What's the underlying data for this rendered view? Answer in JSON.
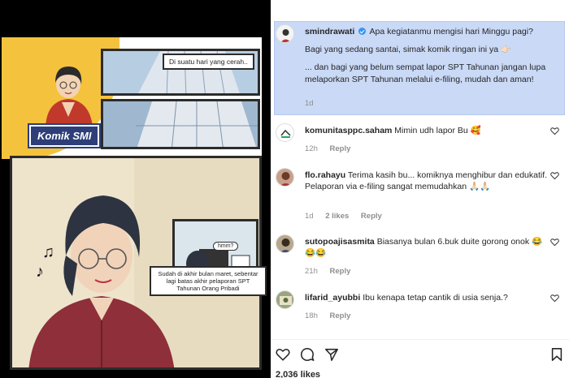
{
  "comic": {
    "caption_top": "Di suatu hari yang cerah..",
    "badge": "Komik SMI",
    "hmm": "hmm?",
    "caption_bottom": "Sudah di akhir bulan maret, sebentar lagi batas akhir pelaporan SPT Tahunan Orang Pribadi"
  },
  "post": {
    "author": "smindrawati",
    "caption_line1": "Apa kegiatanmu mengisi hari Minggu pagi?",
    "caption_line2": "Bagi yang sedang santai, simak komik ringan ini ya 👉🏻",
    "caption_line3": "... dan bagi yang belum sempat lapor SPT Tahunan jangan lupa melaporkan SPT Tahunan melalui e-filing, mudah dan aman!",
    "time": "1d"
  },
  "comments": [
    {
      "user": "komunitasppc.saham",
      "text": "Mimin udh lapor Bu 🥰",
      "time": "12h",
      "likes": "",
      "reply": "Reply"
    },
    {
      "user": "flo.rahayu",
      "text": "Terima kasih bu... komiknya menghibur dan edukatif.",
      "text2": "Pelaporan via e-filing sangat memudahkan 🙏🏻🙏🏻",
      "time": "1d",
      "likes": "2 likes",
      "reply": "Reply"
    },
    {
      "user": "sutopoajisasmita",
      "text": "Biasanya bulan 6.buk duite gorong onok 😂😂😂",
      "time": "21h",
      "likes": "",
      "reply": "Reply"
    },
    {
      "user": "lifarid_ayubbi",
      "text": "Ibu kenapa tetap cantik di usia senja.?",
      "time": "18h",
      "likes": "",
      "reply": "Reply"
    }
  ],
  "likes_count": "2,036 likes",
  "icons": [
    "heart-icon",
    "comment-icon",
    "share-icon",
    "bookmark-icon",
    "verified-icon"
  ]
}
